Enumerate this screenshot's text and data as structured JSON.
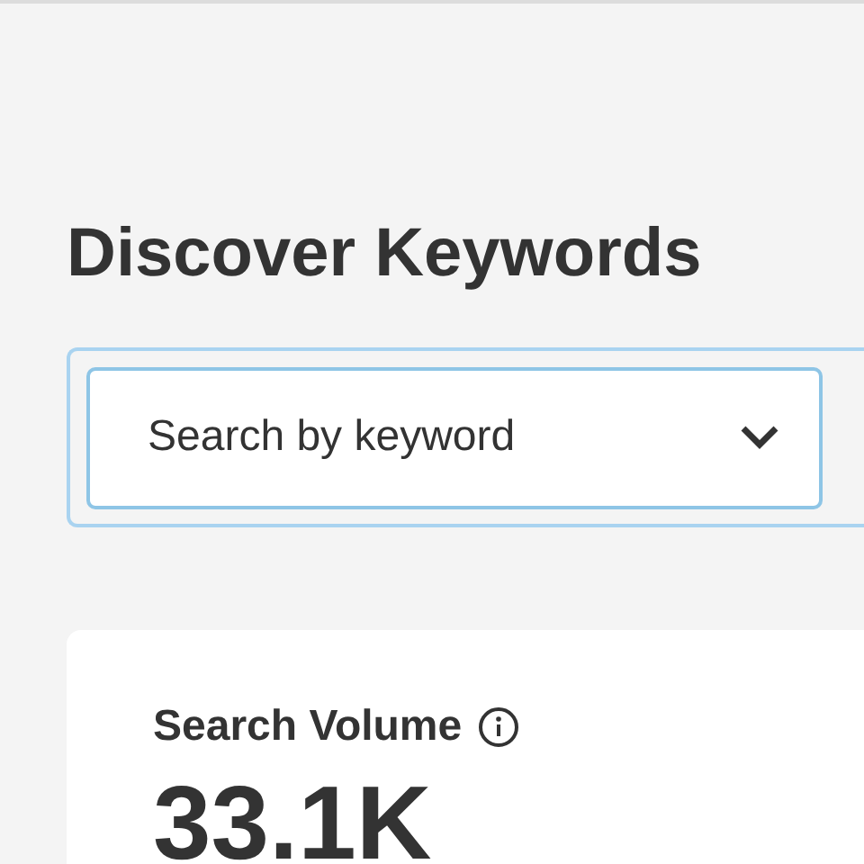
{
  "title": "Discover Keywords",
  "search": {
    "placeholder": "Search by keyword"
  },
  "card": {
    "label": "Search Volume",
    "value": "33.1K"
  }
}
